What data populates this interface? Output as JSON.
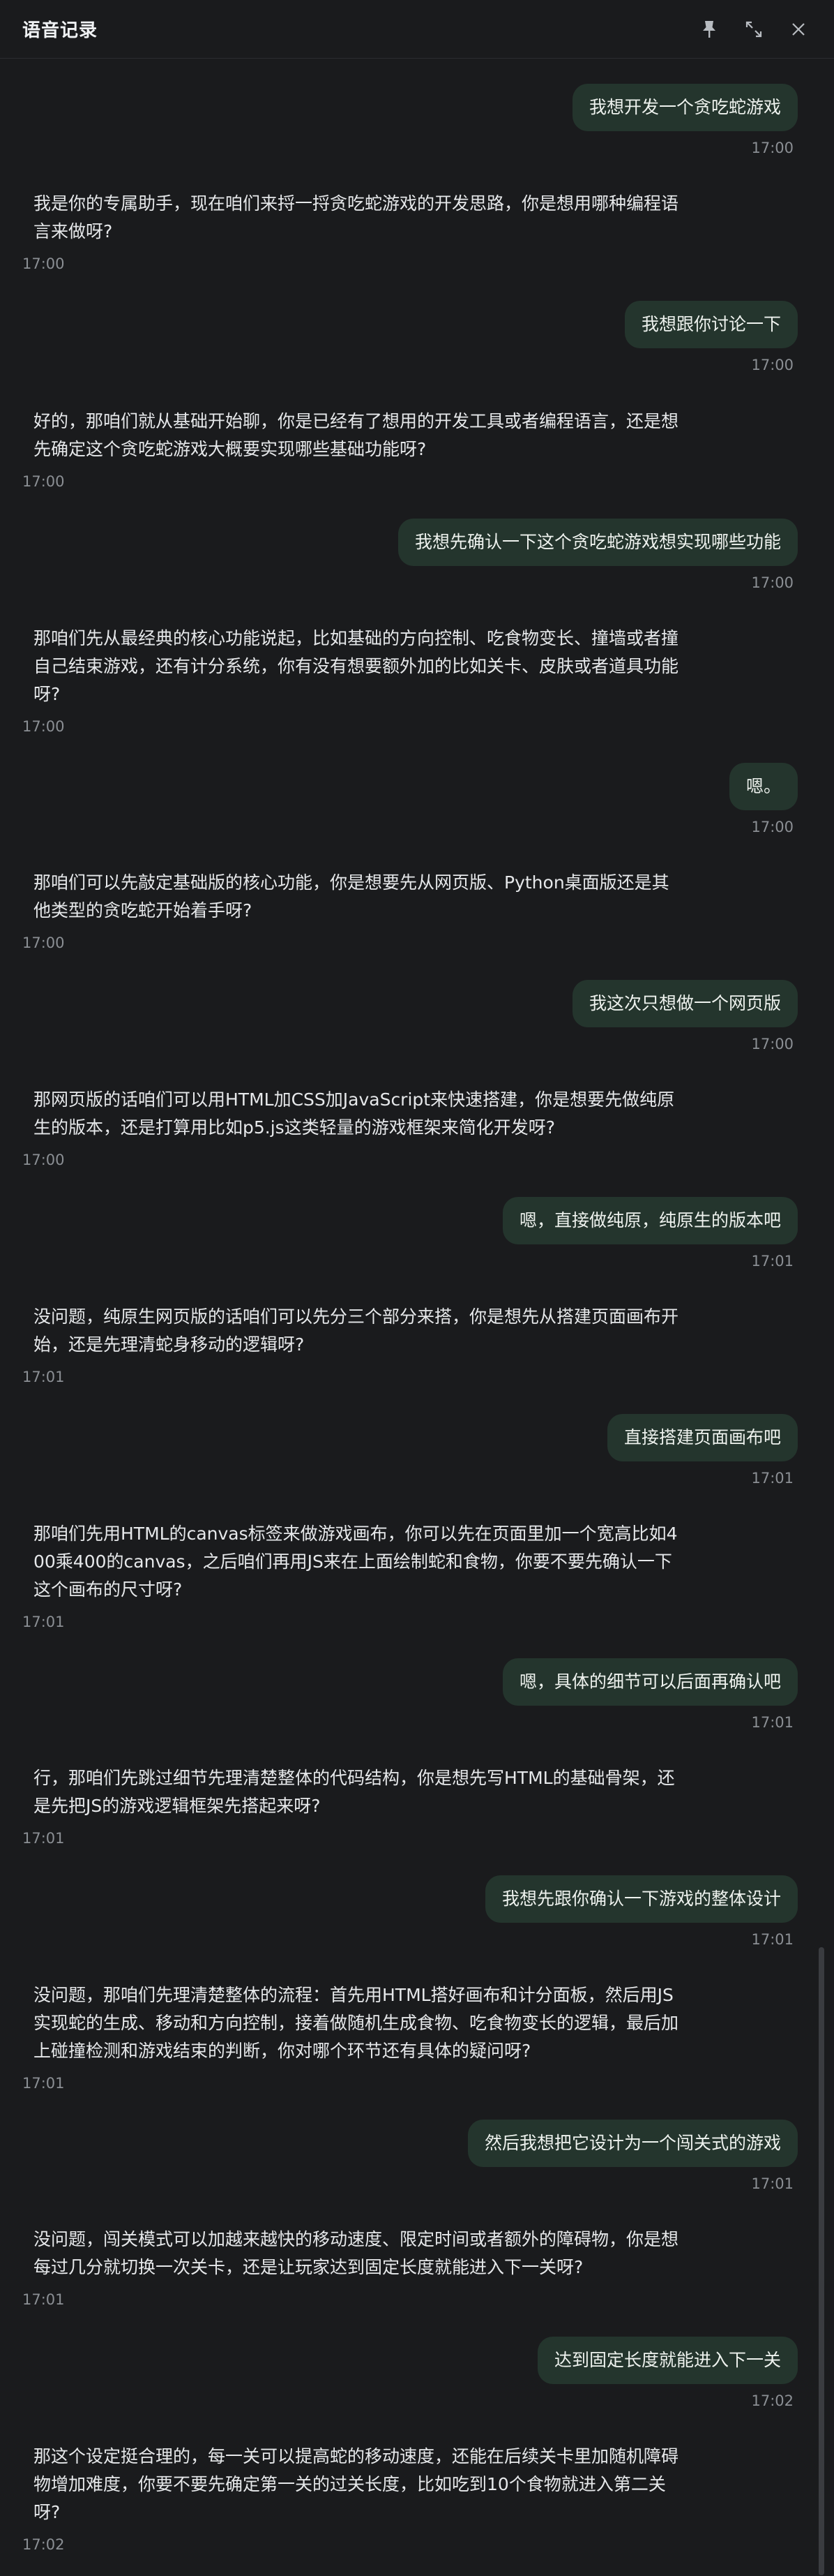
{
  "window": {
    "title": "语音记录"
  },
  "messages": [
    {
      "role": "user",
      "text": "我想开发一个贪吃蛇游戏",
      "time": "17:00"
    },
    {
      "role": "ai",
      "text": "我是你的专属助手，现在咱们来捋一捋贪吃蛇游戏的开发思路，你是想用哪种编程语言来做呀?",
      "time": "17:00"
    },
    {
      "role": "user",
      "text": "我想跟你讨论一下",
      "time": "17:00"
    },
    {
      "role": "ai",
      "text": "好的，那咱们就从基础开始聊，你是已经有了想用的开发工具或者编程语言，还是想先确定这个贪吃蛇游戏大概要实现哪些基础功能呀?",
      "time": "17:00"
    },
    {
      "role": "user",
      "text": "我想先确认一下这个贪吃蛇游戏想实现哪些功能",
      "time": "17:00"
    },
    {
      "role": "ai",
      "text": "那咱们先从最经典的核心功能说起，比如基础的方向控制、吃食物变长、撞墙或者撞自己结束游戏，还有计分系统，你有没有想要额外加的比如关卡、皮肤或者道具功能呀?",
      "time": "17:00"
    },
    {
      "role": "user",
      "text": "嗯。",
      "time": "17:00"
    },
    {
      "role": "ai",
      "text": "那咱们可以先敲定基础版的核心功能，你是想要先从网页版、Python桌面版还是其他类型的贪吃蛇开始着手呀?",
      "time": "17:00"
    },
    {
      "role": "user",
      "text": "我这次只想做一个网页版",
      "time": "17:00"
    },
    {
      "role": "ai",
      "text": "那网页版的话咱们可以用HTML加CSS加JavaScript来快速搭建，你是想要先做纯原生的版本，还是打算用比如p5.js这类轻量的游戏框架来简化开发呀?",
      "time": "17:00"
    },
    {
      "role": "user",
      "text": "嗯，直接做纯原，纯原生的版本吧",
      "time": "17:01"
    },
    {
      "role": "ai",
      "text": "没问题，纯原生网页版的话咱们可以先分三个部分来搭，你是想先从搭建页面画布开始，还是先理清蛇身移动的逻辑呀?",
      "time": "17:01"
    },
    {
      "role": "user",
      "text": "直接搭建页面画布吧",
      "time": "17:01"
    },
    {
      "role": "ai",
      "text": "那咱们先用HTML的canvas标签来做游戏画布，你可以先在页面里加一个宽高比如400乘400的canvas，之后咱们再用JS来在上面绘制蛇和食物，你要不要先确认一下这个画布的尺寸呀?",
      "time": "17:01"
    },
    {
      "role": "user",
      "text": "嗯，具体的细节可以后面再确认吧",
      "time": "17:01"
    },
    {
      "role": "ai",
      "text": "行，那咱们先跳过细节先理清楚整体的代码结构，你是想先写HTML的基础骨架，还是先把JS的游戏逻辑框架先搭起来呀?",
      "time": "17:01"
    },
    {
      "role": "user",
      "text": "我想先跟你确认一下游戏的整体设计",
      "time": "17:01"
    },
    {
      "role": "ai",
      "text": "没问题，那咱们先理清楚整体的流程：首先用HTML搭好画布和计分面板，然后用JS实现蛇的生成、移动和方向控制，接着做随机生成食物、吃食物变长的逻辑，最后加上碰撞检测和游戏结束的判断，你对哪个环节还有具体的疑问呀?",
      "time": "17:01"
    },
    {
      "role": "user",
      "text": "然后我想把它设计为一个闯关式的游戏",
      "time": "17:01"
    },
    {
      "role": "ai",
      "text": "没问题，闯关模式可以加越来越快的移动速度、限定时间或者额外的障碍物，你是想每过几分就切换一次关卡，还是让玩家达到固定长度就能进入下一关呀?",
      "time": "17:01"
    },
    {
      "role": "user",
      "text": "达到固定长度就能进入下一关",
      "time": "17:02"
    },
    {
      "role": "ai",
      "text": "那这个设定挺合理的，每一关可以提高蛇的移动速度，还能在后续关卡里加随机障碍物增加难度，你要不要先确定第一关的过关长度，比如吃到10个食物就进入第二关呀?",
      "time": "17:02"
    }
  ]
}
